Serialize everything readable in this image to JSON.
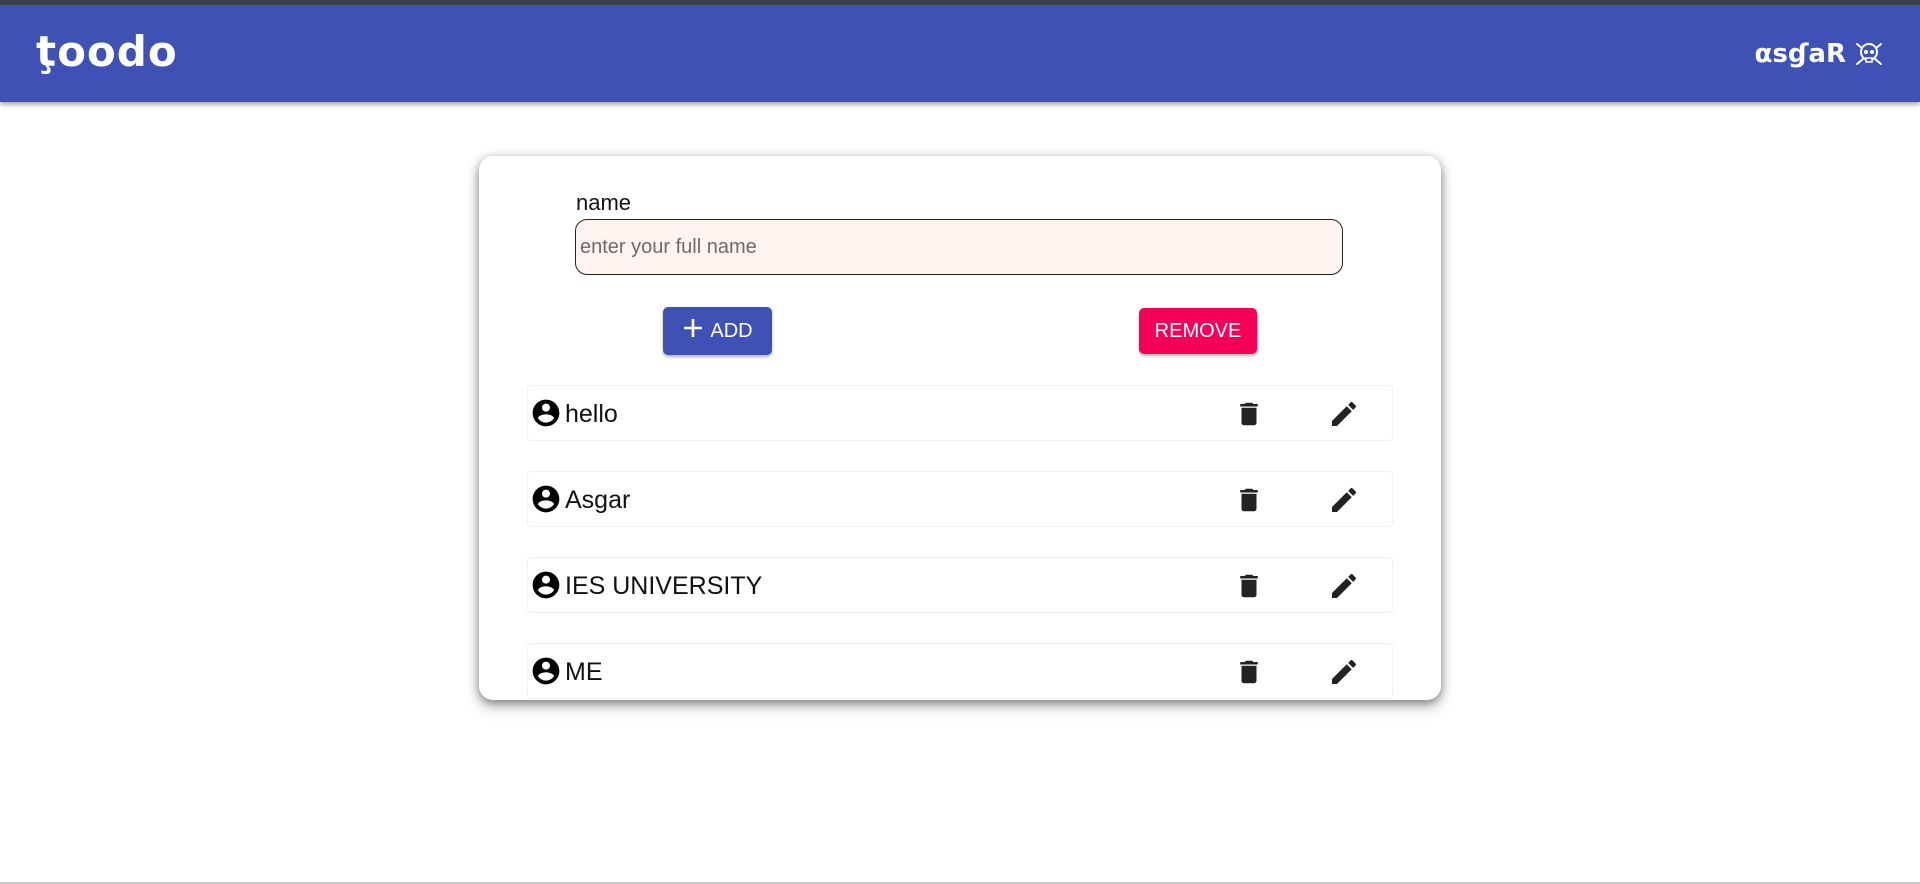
{
  "header": {
    "brand": "ţoodo",
    "user": "αsɠaR",
    "user_icon": "skull-crossbones-icon",
    "bar_color": "#3f51b5"
  },
  "form": {
    "label": "name",
    "placeholder": "enter your full name",
    "value": "",
    "add_label": "ADD",
    "add_icon": "plus-icon",
    "remove_label": "REMOVE",
    "add_color": "#3f51b5",
    "remove_color": "#f50057"
  },
  "items": [
    {
      "label": "hello",
      "icon": "account-circle-icon"
    },
    {
      "label": "Asgar",
      "icon": "account-circle-icon"
    },
    {
      "label": "IES UNIVERSITY",
      "icon": "account-circle-icon"
    },
    {
      "label": "ME",
      "icon": "account-circle-icon"
    }
  ],
  "row_actions": {
    "delete_icon": "trash-icon",
    "edit_icon": "pencil-icon"
  }
}
